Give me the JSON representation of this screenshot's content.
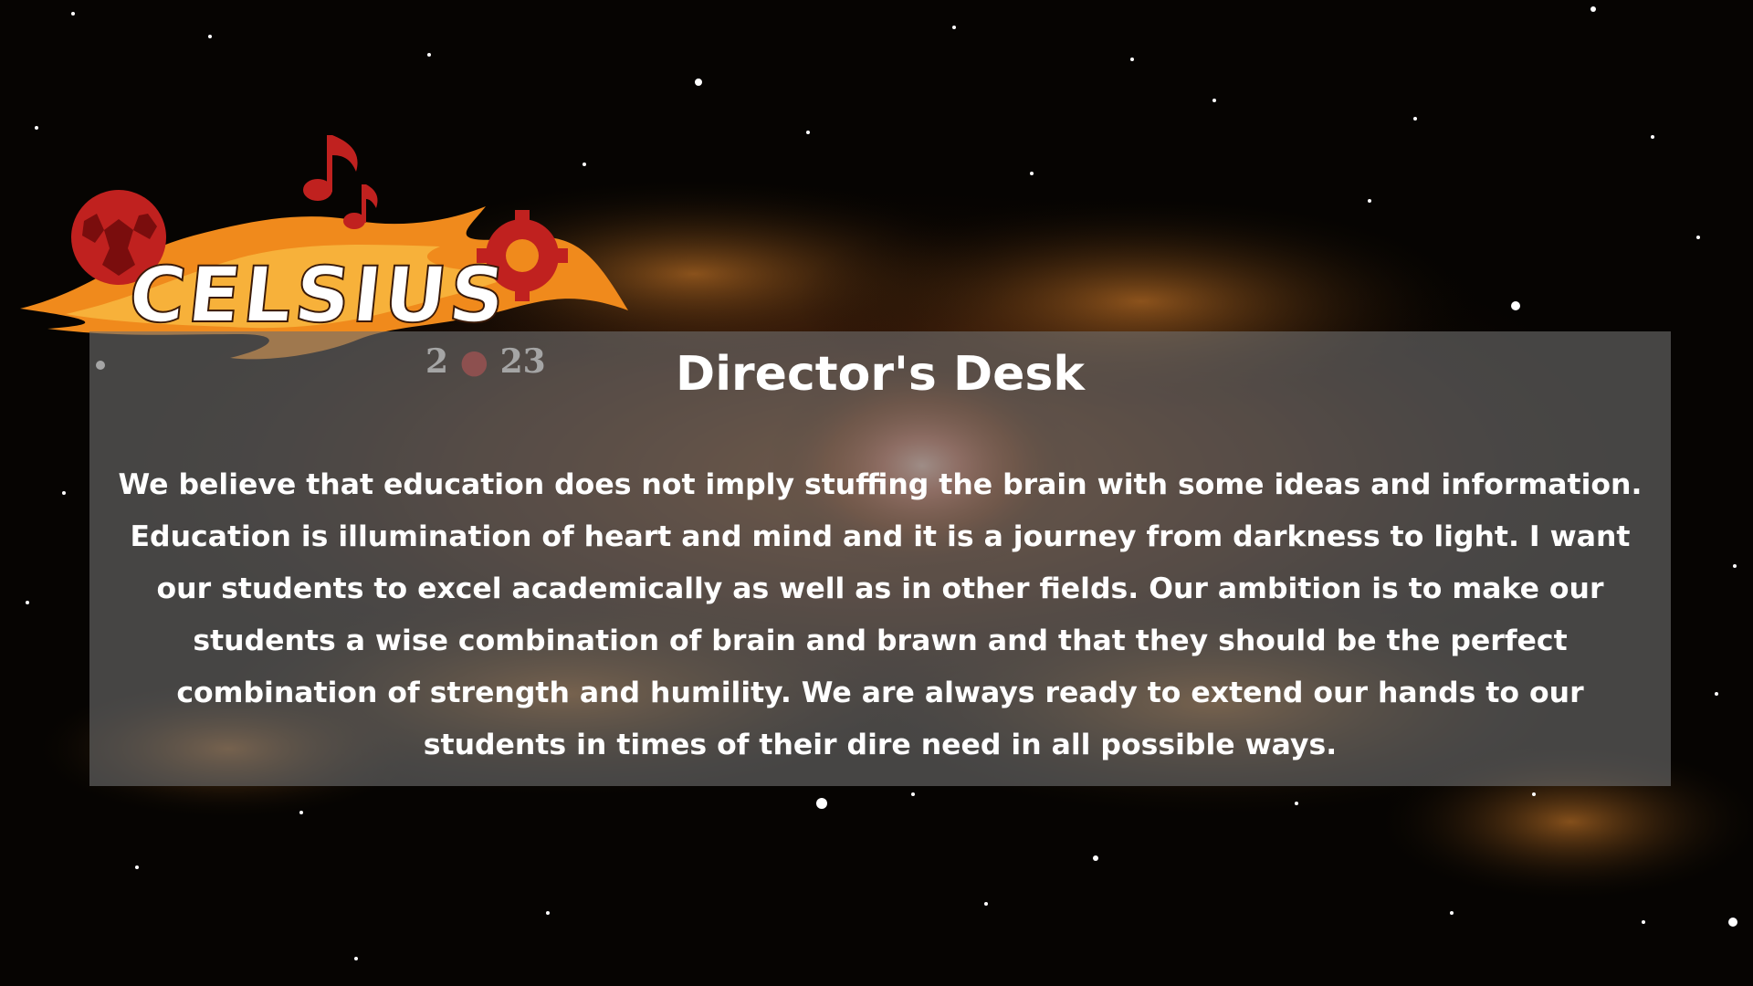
{
  "logo": {
    "name": "CELSIUS",
    "year": "2023",
    "year_left": "2",
    "year_right": "23"
  },
  "panel": {
    "title": "Director's Desk",
    "body": "We believe that education does not imply stuffing the brain with some ideas and information. Education is illumination of heart and mind and it is a journey from darkness to light. I want our students to excel academically as well as in other fields. Our ambition is to make our students a wise combination of brain and brawn and that they should be the perfect combination of strength and humility. We are always ready to extend our hands to our students in times of their dire need in all possible ways."
  },
  "colors": {
    "panel_background": "#6e6e6e",
    "text": "#ffffff",
    "nebula_orange": "#c8641e",
    "logo_red": "#c0211f",
    "flame_orange": "#f08a1c"
  }
}
